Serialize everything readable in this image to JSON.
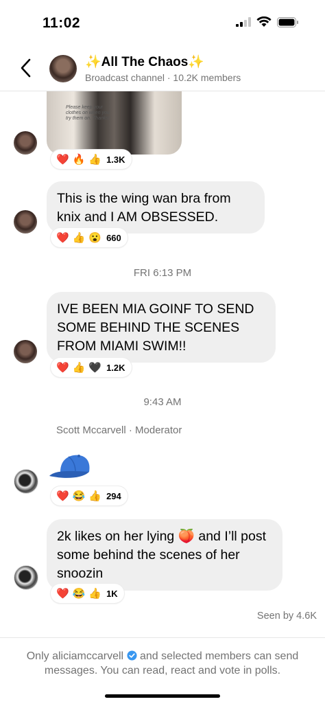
{
  "status_bar": {
    "time": "11:02"
  },
  "header": {
    "title": "✨All The Chaos✨",
    "subtitle": "Broadcast channel · 10.2K members"
  },
  "messages": [
    {
      "photo_caption": "Please keep your clothes on when you try them on. Thanks!",
      "reactions": [
        "❤️",
        "🔥",
        "👍"
      ],
      "count": "1.3K"
    },
    {
      "text": "This is the wing wan bra from knix and I AM OBSESSED.",
      "reactions": [
        "❤️",
        "👍",
        "😮"
      ],
      "count": "660"
    },
    {
      "text": "IVE BEEN MIA GOINF TO SEND SOME BEHIND THE SCENES FROM MIAMI SWIM!!",
      "reactions": [
        "❤️",
        "👍",
        "🖤"
      ],
      "count": "1.2K"
    },
    {
      "sticker": "blue-cap",
      "reactions": [
        "❤️",
        "😂",
        "👍"
      ],
      "count": "294"
    },
    {
      "text_before_emoji": "2k likes on her lying ",
      "inline_emoji": "🍑",
      "text_after_emoji": " and I’ll post some behind the scenes of her snoozin",
      "reactions": [
        "❤️",
        "😂",
        "👍"
      ],
      "count": "1K"
    }
  ],
  "timestamps": {
    "first": "FRI 6:13 PM",
    "second": "9:43 AM"
  },
  "sender_label": "Scott Mccarvell · Moderator",
  "seen": "Seen by 4.6K",
  "footer": {
    "prefix": "Only aliciamccarvell",
    "suffix": " and selected members can send messages. You can read, react and vote in polls."
  }
}
